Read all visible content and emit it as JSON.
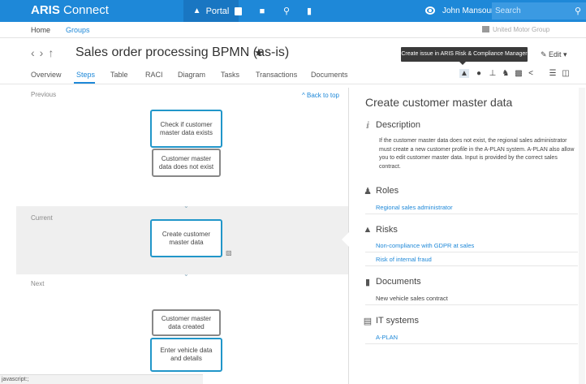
{
  "app": {
    "brand_bold": "ARIS",
    "brand_rest": " Connect"
  },
  "topnav": {
    "portal": "Portal"
  },
  "user": {
    "name": "John Mansour ▾"
  },
  "search": {
    "placeholder": "Search"
  },
  "breadcrumb": {
    "home": "Home",
    "groups": "Groups",
    "organization": "United Motor Group"
  },
  "page": {
    "title": "Sales order processing BPMN (as-is)",
    "edit_label": "Edit ▾",
    "tooltip": "Create issue in ARIS Risk & Compliance Manager"
  },
  "tabs": [
    "Overview",
    "Steps",
    "Table",
    "RACI",
    "Diagram",
    "Tasks",
    "Transactions",
    "Documents"
  ],
  "active_tab": "Steps",
  "steps": {
    "previous_label": "Previous",
    "current_label": "Current",
    "next_label": "Next",
    "back_to_top": "Back to top",
    "previous": [
      "Check if customer master data exists",
      "Customer master data does not exist"
    ],
    "current": "Create customer master data",
    "next": [
      "Customer master data created",
      "Enter vehicle data and details"
    ]
  },
  "detail": {
    "title": "Create customer master data",
    "description_heading": "Description",
    "description": "If the customer master data does not exist, the regional sales administrator must create a new customer profile in the A-PLAN system. A-PLAN also allow you to edit customer master data. Input is provided by the correct sales contract.",
    "roles_heading": "Roles",
    "roles": [
      "Regional sales administrator"
    ],
    "risks_heading": "Risks",
    "risks": [
      "Non-compliance with GDPR at sales",
      "Risk of internal fraud"
    ],
    "documents_heading": "Documents",
    "documents": [
      "New vehicle sales contract"
    ],
    "it_heading": "IT systems",
    "it_systems": [
      "A-PLAN"
    ]
  },
  "status_bar": "javascript:;",
  "colors": {
    "accent": "#1e88d8",
    "node_border": "#2196c9"
  }
}
